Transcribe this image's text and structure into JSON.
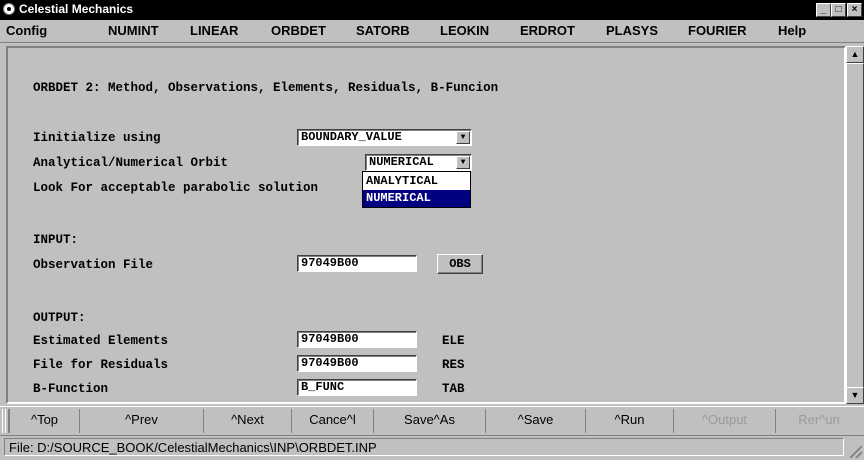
{
  "window": {
    "title": "Celestial Mechanics",
    "controls": [
      "_",
      "□",
      "×"
    ]
  },
  "menu": [
    {
      "label": "Config"
    },
    {
      "label": "NUMINT"
    },
    {
      "label": "LINEAR"
    },
    {
      "label": "ORBDET"
    },
    {
      "label": "SATORB"
    },
    {
      "label": "LEOKIN"
    },
    {
      "label": "ERDROT"
    },
    {
      "label": "PLASYS"
    },
    {
      "label": "FOURIER"
    },
    {
      "label": "Help"
    }
  ],
  "form": {
    "heading": "ORBDET 2: Method, Observations, Elements, Residuals, B-Funcion",
    "initialize_label": "Iinitialize using",
    "initialize_value": "BOUNDARY_VALUE",
    "orbit_label": "Analytical/Numerical Orbit",
    "orbit_value": "NUMERICAL",
    "orbit_options": [
      "ANALYTICAL",
      "NUMERICAL"
    ],
    "parabolic_label": "Look For acceptable parabolic solution",
    "input_heading": "INPUT:",
    "obs_label": "Observation File",
    "obs_value": "97049B00",
    "obs_button": "OBS",
    "output_heading": "OUTPUT:",
    "ele_label": "Estimated Elements",
    "ele_value": "97049B00",
    "ele_ext": "ELE",
    "res_label": "File for Residuals",
    "res_value": "97049B00",
    "res_ext": "RES",
    "bfunc_label": "B-Function",
    "bfunc_value": "B_FUNC",
    "bfunc_ext": "TAB"
  },
  "toolbar": [
    {
      "label": "^Top",
      "enabled": true
    },
    {
      "label": "^Prev",
      "enabled": true
    },
    {
      "label": "^Next",
      "enabled": true
    },
    {
      "label": "Cance^l",
      "enabled": true
    },
    {
      "label": "Save^As",
      "enabled": true
    },
    {
      "label": "^Save",
      "enabled": true
    },
    {
      "label": "^Run",
      "enabled": true
    },
    {
      "label": "^Output",
      "enabled": false
    },
    {
      "label": "Rer^un",
      "enabled": false
    }
  ],
  "status": {
    "text": "File: D:/SOURCE_BOOK/CelestialMechanics\\INP\\ORBDET.INP"
  }
}
